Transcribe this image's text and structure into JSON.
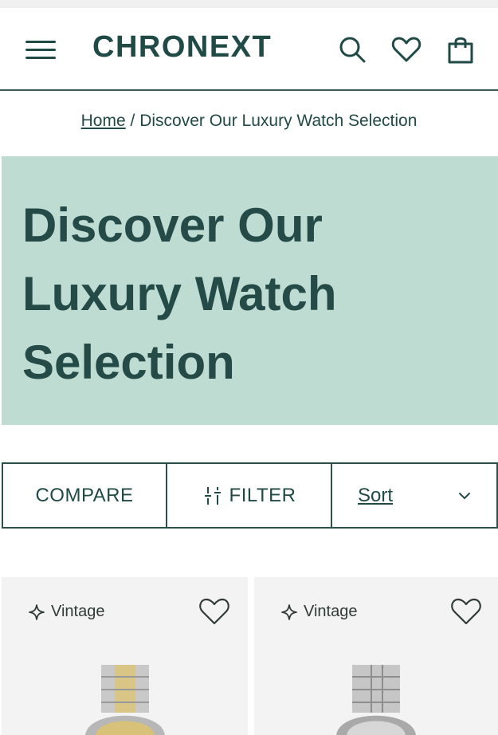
{
  "header": {
    "logo": "CHRONEXT",
    "icons": [
      "menu-icon",
      "search-icon",
      "heart-icon",
      "shopping-bag-icon"
    ]
  },
  "breadcrumb": {
    "home": "Home",
    "separator": "/",
    "current": "Discover Our Luxury Watch Selection"
  },
  "hero": {
    "title": "Discover Our Luxury Watch Selection",
    "background": "#bfdcd2",
    "text_color": "#244b47"
  },
  "toolbar": {
    "compare": "COMPARE",
    "filter": "FILTER",
    "sort": "Sort"
  },
  "products": [
    {
      "badge": "Vintage"
    },
    {
      "badge": "Vintage"
    }
  ],
  "colors": {
    "brand": "#1f4a45",
    "card_bg": "#f3f3f3"
  }
}
